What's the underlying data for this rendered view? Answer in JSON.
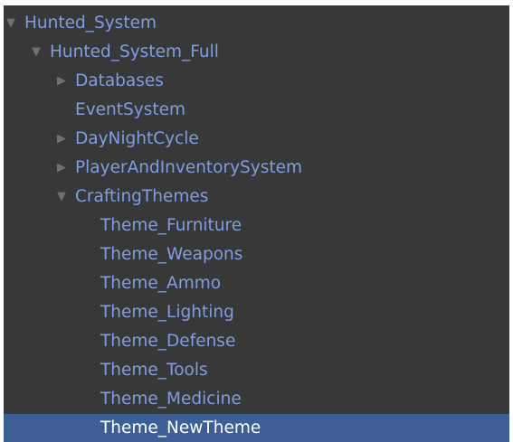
{
  "hierarchy": {
    "items": [
      {
        "label": "Hunted_System",
        "arrow": "▼"
      },
      {
        "label": "Hunted_System_Full",
        "arrow": "▼"
      },
      {
        "label": "Databases",
        "arrow": "▶"
      },
      {
        "label": "EventSystem",
        "arrow": ""
      },
      {
        "label": "DayNightCycle",
        "arrow": "▶"
      },
      {
        "label": "PlayerAndInventorySystem",
        "arrow": "▶"
      },
      {
        "label": "CraftingThemes",
        "arrow": "▼"
      },
      {
        "label": "Theme_Furniture",
        "arrow": ""
      },
      {
        "label": "Theme_Weapons",
        "arrow": ""
      },
      {
        "label": "Theme_Ammo",
        "arrow": ""
      },
      {
        "label": "Theme_Lighting",
        "arrow": ""
      },
      {
        "label": "Theme_Defense",
        "arrow": ""
      },
      {
        "label": "Theme_Tools",
        "arrow": ""
      },
      {
        "label": "Theme_Medicine",
        "arrow": ""
      },
      {
        "label": "Theme_NewTheme",
        "arrow": "",
        "selected": true
      }
    ]
  },
  "colors": {
    "panel_background": "#383838",
    "item_text": "#7f9ee2",
    "selected_background": "#3d5f95",
    "selected_text": "#ffffff",
    "arrow": "#707070"
  },
  "icons": {
    "expanded": "triangle-down-icon",
    "collapsed": "triangle-right-icon"
  }
}
